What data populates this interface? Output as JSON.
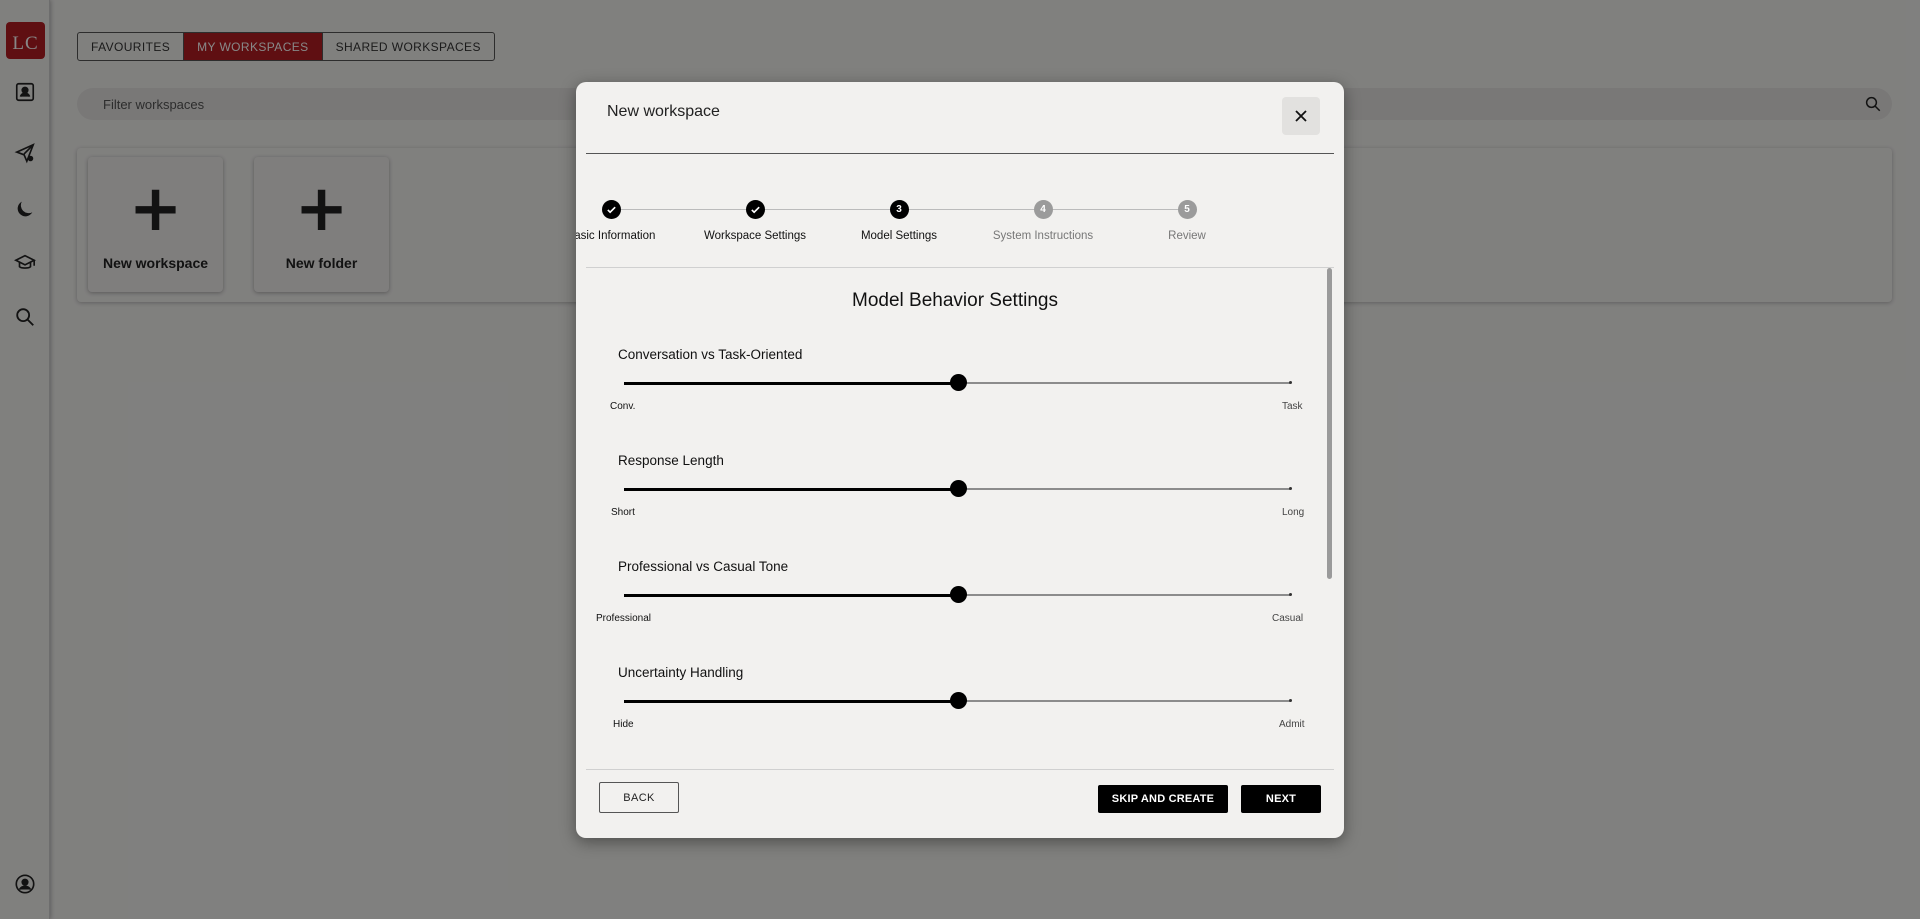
{
  "sidebar": {
    "avatar_initials": "LC",
    "icons": [
      "contact-card-icon",
      "send-icon",
      "moon-icon",
      "graduation-cap-icon",
      "search-icon",
      "user-circle-icon"
    ]
  },
  "tabs": [
    {
      "label": "FAVOURITES",
      "active": false
    },
    {
      "label": "MY WORKSPACES",
      "active": true
    },
    {
      "label": "SHARED WORKSPACES",
      "active": false
    }
  ],
  "filter": {
    "placeholder": "Filter workspaces"
  },
  "cards": [
    {
      "label": "New workspace",
      "icon": "plus-icon"
    },
    {
      "label": "New folder",
      "icon": "plus-icon"
    }
  ],
  "modal": {
    "title": "New workspace",
    "steps": [
      {
        "number": "1",
        "label": "Basic Information",
        "state": "done"
      },
      {
        "number": "2",
        "label": "Workspace Settings",
        "state": "done"
      },
      {
        "number": "3",
        "label": "Model Settings",
        "state": "current"
      },
      {
        "number": "4",
        "label": "System Instructions",
        "state": "todo"
      },
      {
        "number": "5",
        "label": "Review",
        "state": "todo"
      }
    ],
    "section_title": "Model Behavior Settings",
    "sliders": [
      {
        "title": "Conversation vs Task-Oriented",
        "min_label": "Conv.",
        "max_label": "Task",
        "value": 0.5
      },
      {
        "title": "Response Length",
        "min_label": "Short",
        "max_label": "Long",
        "value": 0.5
      },
      {
        "title": "Professional vs Casual Tone",
        "min_label": "Professional",
        "max_label": "Casual",
        "value": 0.5
      },
      {
        "title": "Uncertainty Handling",
        "min_label": "Hide",
        "max_label": "Admit",
        "value": 0.5
      }
    ],
    "buttons": {
      "back": "BACK",
      "skip": "SKIP AND CREATE",
      "next": "NEXT"
    }
  },
  "colors": {
    "accent": "#b41e22",
    "background": "#f2f1ef",
    "primary_button": "#000000"
  }
}
